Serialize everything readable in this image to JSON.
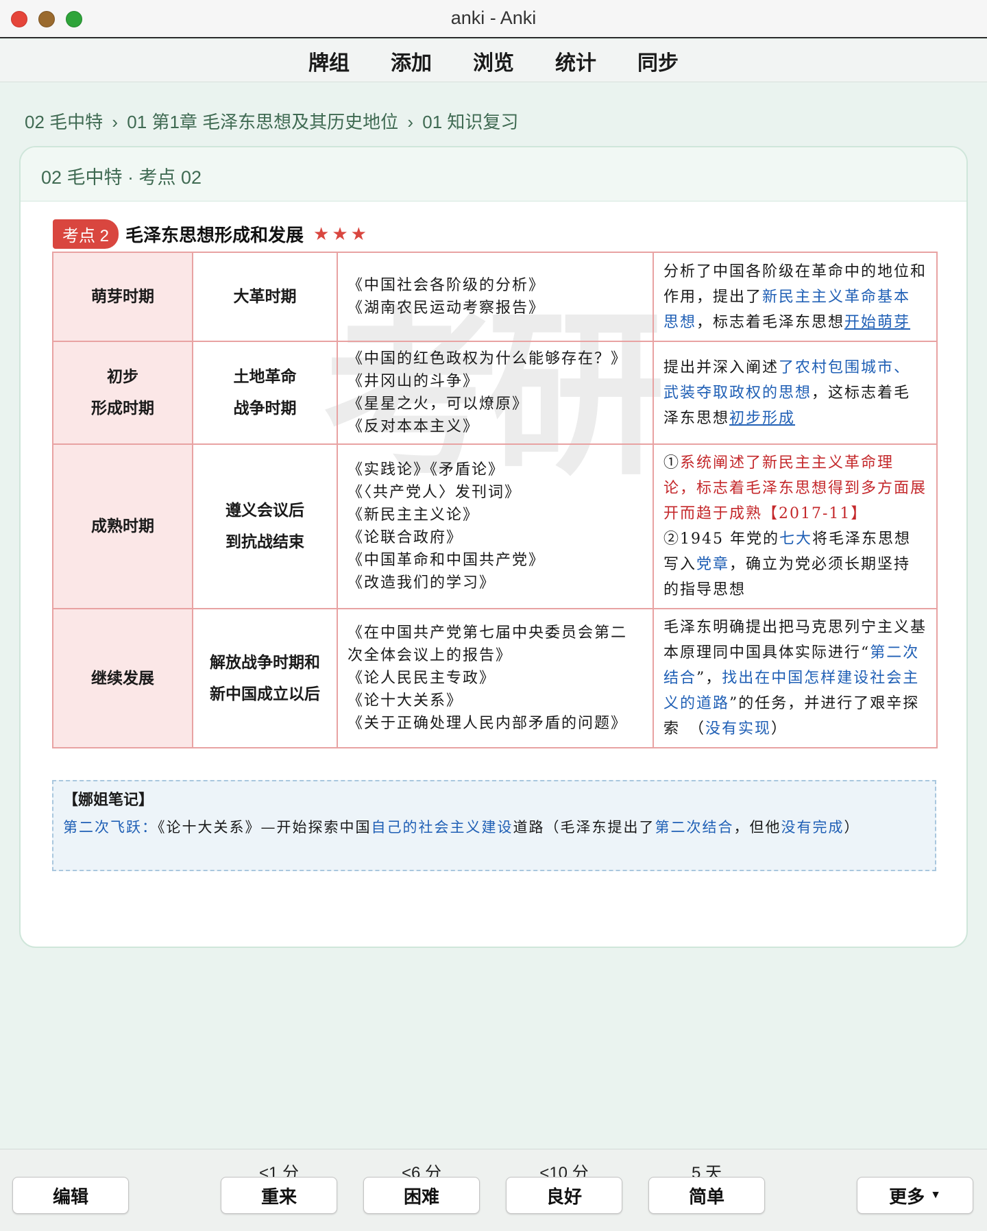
{
  "window": {
    "title": "anki - Anki"
  },
  "toolbar": {
    "items": [
      "牌组",
      "添加",
      "浏览",
      "统计",
      "同步"
    ]
  },
  "breadcrumb": [
    "02 毛中特",
    "01 第1章 毛泽东思想及其历史地位",
    "01 知识复习"
  ],
  "breadcrumb_separator": "›",
  "card": {
    "header": "02 毛中特 · 考点 02",
    "watermark": "考研",
    "kaodian": {
      "badge": "考点 2",
      "title": "毛泽东思想形成和发展",
      "stars": "★★★"
    },
    "rows": [
      {
        "period": [
          "萌芽时期"
        ],
        "era": [
          "大革时期"
        ],
        "works": [
          "《中国社会各阶级的分析》",
          "《湖南农民运动考察报告》"
        ],
        "desc": [
          {
            "t": "分析了中国各阶级在革命中的地位和作用，提出了"
          },
          {
            "t": "新民主主义革命基本思想",
            "c": "blue"
          },
          {
            "t": "，标志着毛泽东思想"
          },
          {
            "t": "开始萌芽",
            "c": "blue",
            "u": true
          }
        ]
      },
      {
        "period": [
          "初步",
          "形成时期"
        ],
        "era": [
          "土地革命",
          "战争时期"
        ],
        "works": [
          "《中国的红色政权为什么能够存在？》",
          "《井冈山的斗争》",
          "《星星之火，可以燎原》",
          "《反对本本主义》"
        ],
        "desc": [
          {
            "t": "提出并深入阐述"
          },
          {
            "t": "了农村包围城市、武装夺取政权的思想",
            "c": "blue"
          },
          {
            "t": "，这标志着毛泽东思想"
          },
          {
            "t": "初步形成",
            "c": "blue",
            "u": true
          }
        ]
      },
      {
        "period": [
          "成熟时期"
        ],
        "era": [
          "遵义会议后",
          "到抗战结束"
        ],
        "works": [
          "《实践论》《矛盾论》",
          "《〈共产党人〉发刊词》",
          "《新民主主义论》",
          "《论联合政府》",
          "《中国革命和中国共产党》",
          "《改造我们的学习》"
        ],
        "desc": [
          {
            "t": "①"
          },
          {
            "t": "系统阐述了新民主主义革命理论，标志着毛泽东思想得到多方面展开而趋于成熟【2017-11】",
            "c": "red"
          },
          {
            "br": true
          },
          {
            "t": "②1945 年党的"
          },
          {
            "t": "七大",
            "c": "blue"
          },
          {
            "t": "将毛泽东思想写入"
          },
          {
            "t": "党章",
            "c": "blue"
          },
          {
            "t": "，确立为党必须长期坚持的指导思想"
          }
        ]
      },
      {
        "period": [
          "继续发展"
        ],
        "era": [
          "解放战争时期和",
          "新中国成立以后"
        ],
        "works": [
          "《在中国共产党第七届中央委员会第二次全体会议上的报告》",
          "《论人民民主专政》",
          "《论十大关系》",
          "《关于正确处理人民内部矛盾的问题》"
        ],
        "desc": [
          {
            "t": "毛泽东明确提出把马克思列宁主义基本原理同中国具体实际进行“"
          },
          {
            "t": "第二次结合",
            "c": "blue"
          },
          {
            "t": "”，"
          },
          {
            "t": "找出在中国怎样建设社会主义的道路",
            "c": "blue"
          },
          {
            "t": "”的任务，并进行了艰辛探索　（"
          },
          {
            "t": "没有实现",
            "c": "blue"
          },
          {
            "t": "）"
          }
        ]
      }
    ],
    "notes": {
      "title": "【娜姐笔记】",
      "body": [
        {
          "t": "第二次飞跃：",
          "c": "blue"
        },
        {
          "t": "《论十大关系》—开始探索中国"
        },
        {
          "t": "自己的社会主义建设",
          "c": "blue"
        },
        {
          "t": "道路（毛泽东提出了"
        },
        {
          "t": "第二次结合",
          "c": "blue"
        },
        {
          "t": "，但他"
        },
        {
          "t": "没有完成",
          "c": "blue"
        },
        {
          "t": "）"
        }
      ]
    }
  },
  "colors": {
    "blue": "#1f5fb5",
    "red": "#c4282b",
    "accent": "#d9463f"
  },
  "bottom": {
    "edit_label": "编辑",
    "more_label": "更多",
    "answers": [
      {
        "time": "<1 分",
        "label": "重来"
      },
      {
        "time": "<6 分",
        "label": "困难"
      },
      {
        "time": "<10 分",
        "label": "良好"
      },
      {
        "time": "5 天",
        "label": "简单"
      }
    ]
  }
}
